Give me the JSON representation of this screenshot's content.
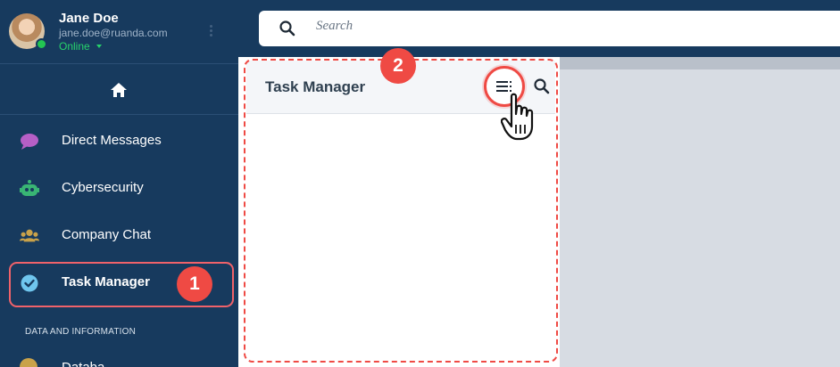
{
  "user": {
    "name": "Jane Doe",
    "email": "jane.doe@ruanda.com",
    "status": "Online"
  },
  "search": {
    "placeholder": "Search"
  },
  "sidebar": {
    "items": [
      {
        "label": "Direct Messages",
        "icon": "speech-bubble-icon",
        "color": "#b65fc6"
      },
      {
        "label": "Cybersecurity",
        "icon": "robot-icon",
        "color": "#39b574"
      },
      {
        "label": "Company Chat",
        "icon": "people-icon",
        "color": "#c9a24a"
      },
      {
        "label": "Task Manager",
        "icon": "check-circle-icon",
        "color": "#6fc6ee"
      }
    ],
    "section_header": "DATA AND INFORMATION",
    "partial_item_label": "Databa"
  },
  "panel": {
    "title": "Task Manager"
  },
  "annotations": {
    "badge_1": "1",
    "badge_2": "2",
    "accent_color": "#ef4a44"
  },
  "colors": {
    "sidebar_bg": "#173a5e",
    "online_green": "#27d36b"
  }
}
